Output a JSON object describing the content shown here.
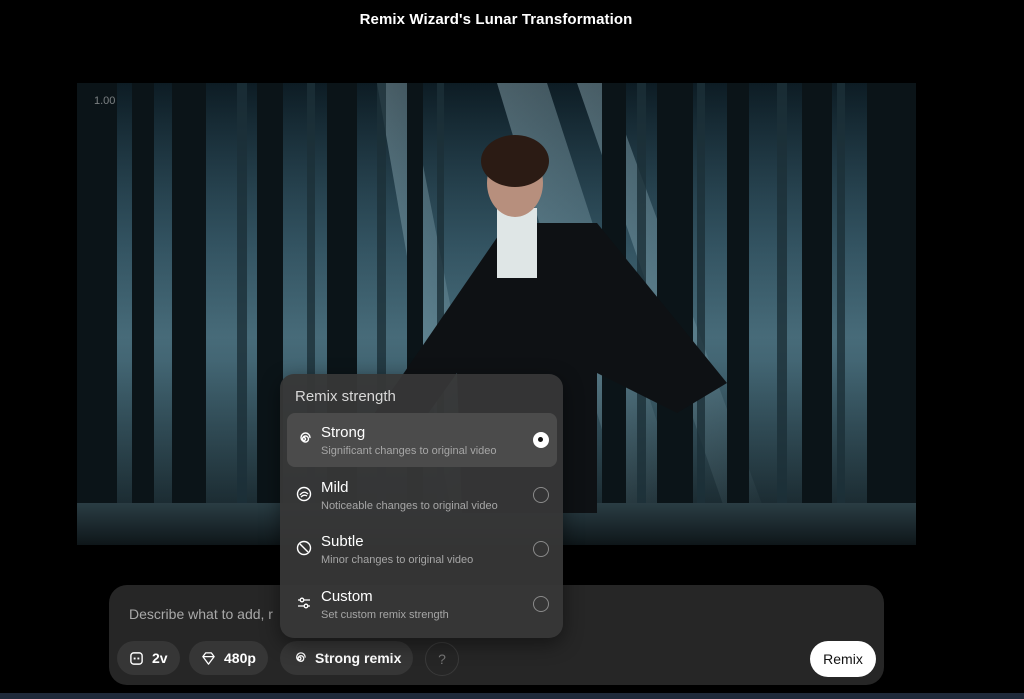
{
  "header": {
    "title": "Remix Wizard's Lunar Transformation"
  },
  "video": {
    "timecode": "1.00"
  },
  "prompt": {
    "placeholder": "Describe what to add, r",
    "chips": {
      "variations": "2v",
      "resolution": "480p",
      "strength": "Strong remix"
    },
    "help": "?",
    "remix_button": "Remix"
  },
  "remix_strength_menu": {
    "title": "Remix strength",
    "options": [
      {
        "label": "Strong",
        "description": "Significant changes to original video",
        "selected": true,
        "icon": "spiral-icon"
      },
      {
        "label": "Mild",
        "description": "Noticeable changes to original video",
        "selected": false,
        "icon": "swirl-icon"
      },
      {
        "label": "Subtle",
        "description": "Minor changes to original video",
        "selected": false,
        "icon": "slash-circle-icon"
      },
      {
        "label": "Custom",
        "description": "Set custom remix strength",
        "selected": false,
        "icon": "sliders-icon"
      }
    ]
  },
  "colors": {
    "background": "#000000",
    "panel": "#262626",
    "popup": "#373737",
    "accent": "#ffffff"
  }
}
